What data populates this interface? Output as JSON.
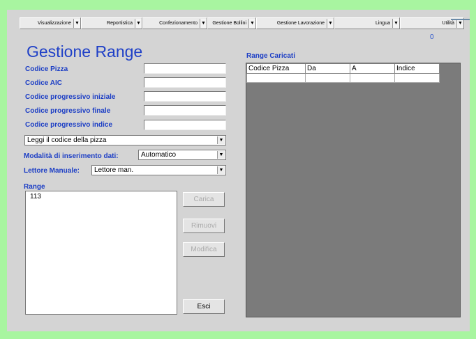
{
  "menu": [
    {
      "label": "Visualizzazione"
    },
    {
      "label": "Reportistica"
    },
    {
      "label": "Confezionamento"
    },
    {
      "label": "Gestione Bollini"
    },
    {
      "label": "Gestione Lavorazione"
    },
    {
      "label": "Lingua"
    },
    {
      "label": "Utilità"
    }
  ],
  "counter": "0",
  "title": "Gestione Range",
  "form": {
    "codice_pizza": "Codice Pizza",
    "codice_aic": "Codice AIC",
    "prog_iniziale": "Codice progressivo iniziale",
    "prog_finale": "Codice progressivo finale",
    "prog_indice": "Codice progressivo indice",
    "leggi_select": "Leggi il codice della pizza",
    "modalita_label": "Modalità di inserimento dati:",
    "modalita_value": "Automatico",
    "lettore_label": "Lettore Manuale:",
    "lettore_value": "Lettore man.",
    "range_label": "Range"
  },
  "range_items": [
    "113"
  ],
  "buttons": {
    "carica": "Carica",
    "rimuovi": "Rimuovi",
    "modifica": "Modifica",
    "esci": "Esci"
  },
  "loaded": {
    "title": "Range Caricati",
    "columns": [
      "Codice Pizza",
      "Da",
      "A",
      "Indice"
    ]
  }
}
